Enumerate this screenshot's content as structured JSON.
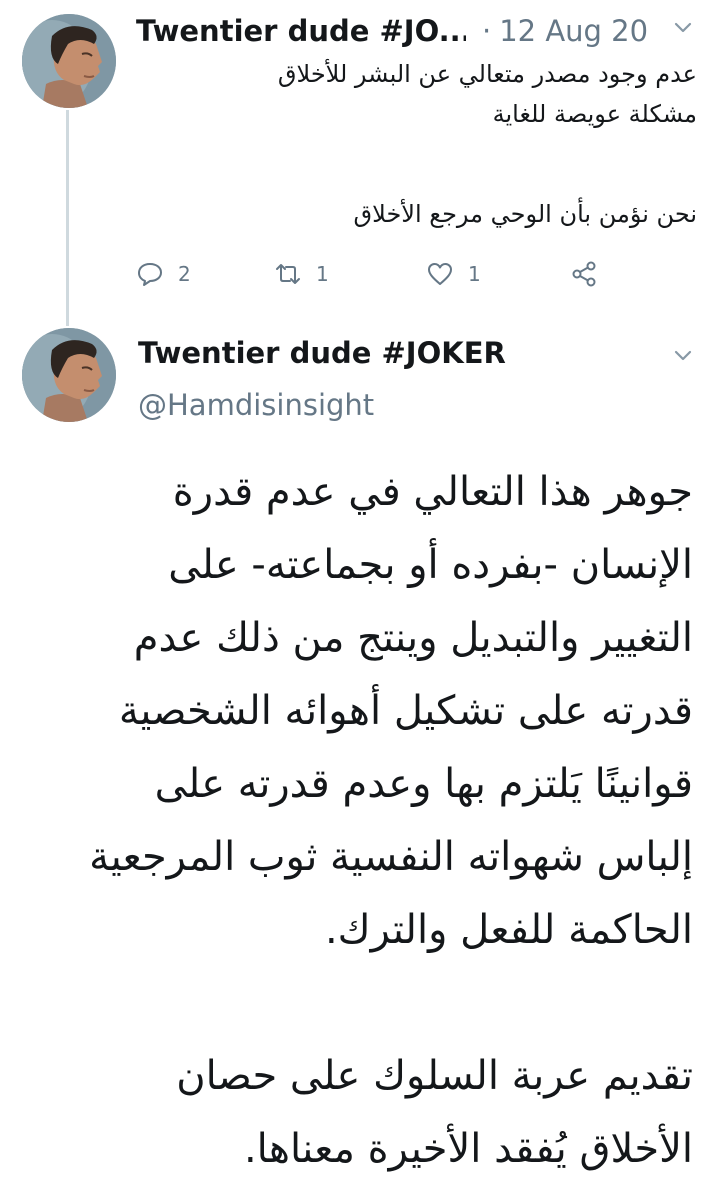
{
  "thread": {
    "reply": {
      "author_name": "Twentier dude #JO...",
      "date": "12 Aug 20",
      "text_lines": [
        "عدم وجود مصدر متعالي عن البشر للأخلاق",
        "مشكلة عويصة للغاية",
        "نحن نؤمن بأن الوحي مرجع الأخلاق"
      ],
      "reply_count": "2",
      "retweet_count": "1",
      "like_count": "1",
      "icons": [
        "reply-icon",
        "retweet-icon",
        "like-icon",
        "share-icon",
        "chevron-down-icon"
      ]
    },
    "main": {
      "author_name": "Twentier dude #JOKER",
      "handle": "@Hamdisinsight",
      "text_lines": [
        "جوهر هذا التعالي في عدم قدرة",
        "الإنسان -بفرده أو بجماعته- على",
        "التغيير والتبديل  وينتج من ذلك عدم",
        "قدرته على تشكيل أهوائه الشخصية",
        "قوانينًا يَلتزم بها وعدم قدرته على",
        "إلباس شهواته النفسية ثوب المرجعية",
        "الحاكمة للفعل والترك.",
        "تقديم عربة السلوك على حصان",
        "الأخلاق يُفقد الأخيرة معناها."
      ]
    }
  },
  "colors": {
    "text": "#14171a",
    "secondary": "#657786",
    "thread_line": "#cfd9de"
  }
}
